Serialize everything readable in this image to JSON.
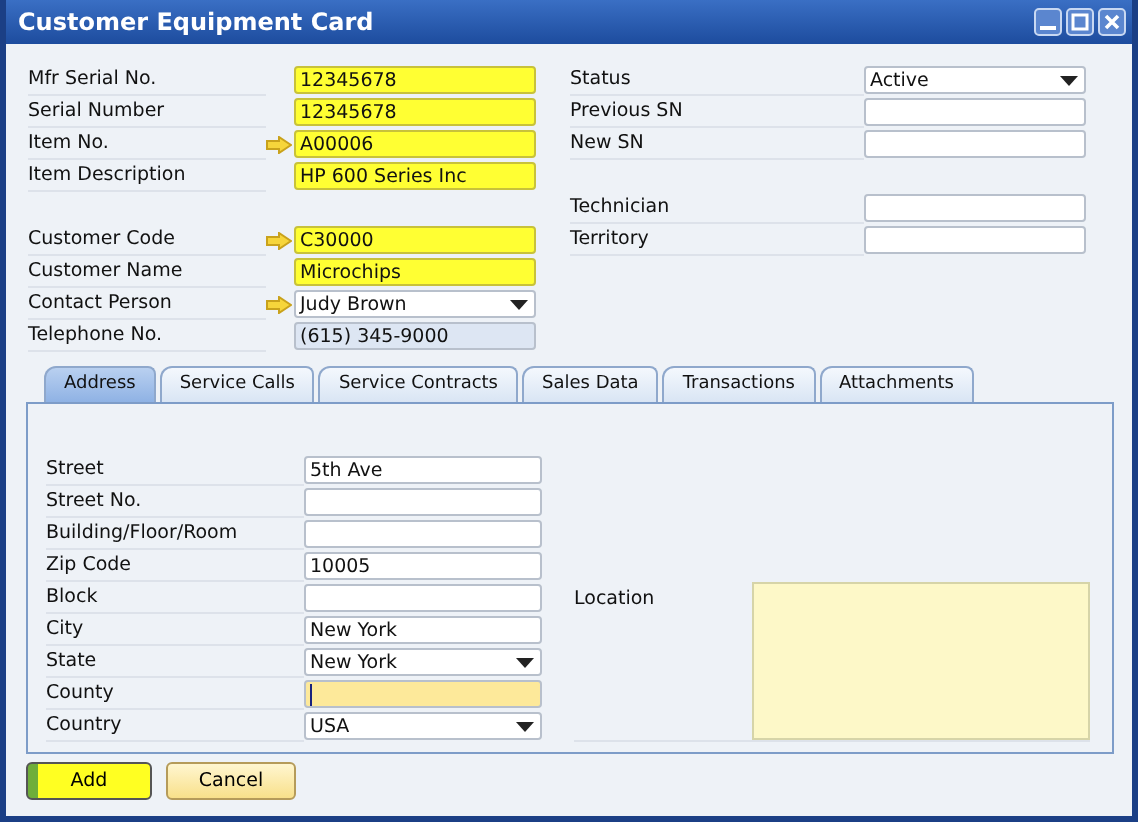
{
  "window": {
    "title": "Customer Equipment Card"
  },
  "header": {
    "left_groups": [
      [
        {
          "label": "Mfr Serial No.",
          "value": "12345678",
          "kind": "required",
          "link": false
        },
        {
          "label": "Serial Number",
          "value": "12345678",
          "kind": "required",
          "link": false
        },
        {
          "label": "Item No.",
          "value": "A00006",
          "kind": "required",
          "link": true
        },
        {
          "label": "Item Description",
          "value": "HP 600 Series Inc",
          "kind": "required",
          "link": false
        }
      ],
      [
        {
          "label": "Customer Code",
          "value": "C30000",
          "kind": "required",
          "link": true
        },
        {
          "label": "Customer Name",
          "value": "Microchips",
          "kind": "required",
          "link": false
        },
        {
          "label": "Contact Person",
          "value": "Judy Brown",
          "kind": "dropdown",
          "link": true
        },
        {
          "label": "Telephone No.",
          "value": "(615) 345-9000",
          "kind": "readonly",
          "link": false
        }
      ]
    ],
    "right_groups": [
      [
        {
          "label": "Status",
          "value": "Active",
          "kind": "dropdown"
        },
        {
          "label": "Previous SN",
          "kind": "text"
        },
        {
          "label": "New SN",
          "kind": "text"
        }
      ],
      [
        {
          "label": "Technician",
          "kind": "text"
        },
        {
          "label": "Territory",
          "kind": "text"
        }
      ]
    ]
  },
  "tabs": [
    {
      "label": "Address",
      "selected": true
    },
    {
      "label": "Service Calls",
      "selected": false
    },
    {
      "label": "Service Contracts",
      "selected": false
    },
    {
      "label": "Sales Data",
      "selected": false
    },
    {
      "label": "Transactions",
      "selected": false
    },
    {
      "label": "Attachments",
      "selected": false
    }
  ],
  "address": {
    "fields": [
      {
        "label": "Street",
        "value": "5th Ave",
        "kind": "text"
      },
      {
        "label": "Street No.",
        "kind": "text"
      },
      {
        "label": "Building/Floor/Room",
        "kind": "text"
      },
      {
        "label": "Zip Code",
        "value": "10005",
        "kind": "text"
      },
      {
        "label": "Block",
        "kind": "text"
      },
      {
        "label": "City",
        "value": "New York",
        "kind": "text"
      },
      {
        "label": "State",
        "value": "New York",
        "kind": "dropdown"
      },
      {
        "label": "County",
        "kind": "focused"
      },
      {
        "label": "Country",
        "value": "USA",
        "kind": "dropdown"
      }
    ],
    "location": {
      "label": "Location"
    }
  },
  "buttons": [
    {
      "label": "Add",
      "kind": "primary"
    },
    {
      "label": "Cancel",
      "kind": "secondary"
    }
  ]
}
